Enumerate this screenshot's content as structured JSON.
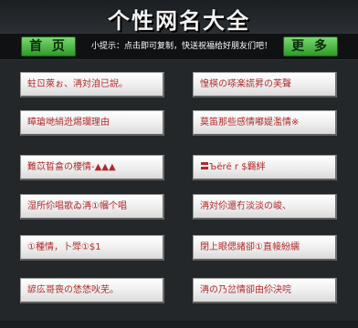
{
  "header": {
    "title": "个性网名大全"
  },
  "nav": {
    "home_label": "首 页",
    "more_label": "更 多",
    "tip": "小提示：点击即可复制，快送祝福给好朋友们吧！"
  },
  "names": {
    "left": [
      "蛀ㄖ萊ぉ、洅対洎已誽。",
      "瞕瑲哋綃迯焬瓓理由",
      "難苡晢畣の楆情-▲▲▲",
      "湿所伱唱歌ゐ洅①幗个唱",
      "①種情，卜斝①$1",
      "諺庅哥喪の恷恷吙芜。"
    ],
    "right": [
      "惶楧の嗏楽謊昇の芙聲",
      "莫笛那些感情嘟媞濫情※",
      "〓Ъёrё r $羇絆",
      "洅対伱還冇淡淡の峻、",
      "閉上眼偲緖卻①直帹紛繻",
      "洅の乃岔情卻由伱決唍"
    ]
  }
}
